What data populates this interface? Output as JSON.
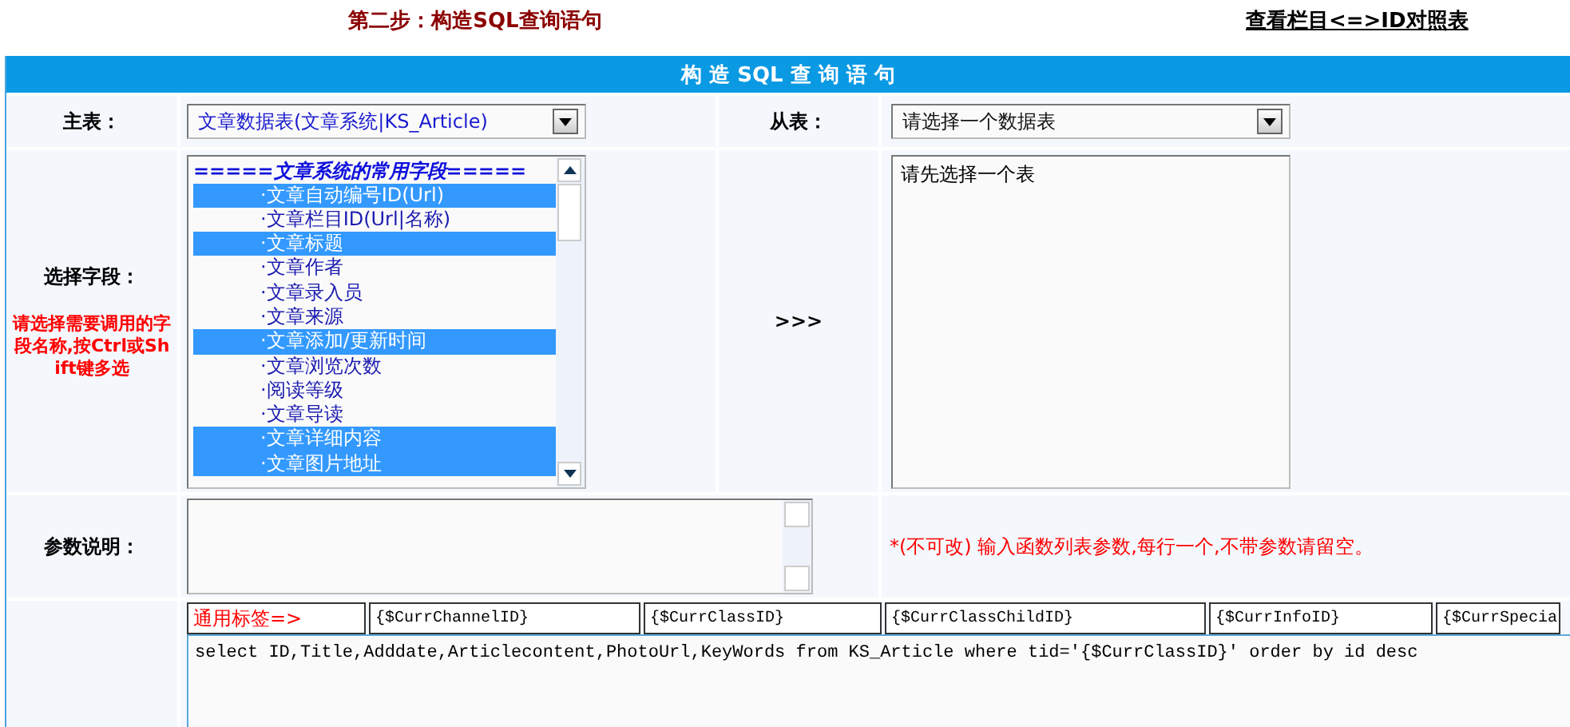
{
  "heading": {
    "title": "第二步：构造SQL查询语句",
    "link": "查看栏目<=>ID对照表"
  },
  "section_title": "构 造 SQL 查 询 语 句",
  "main_table": {
    "label": "主表：",
    "value": "文章数据表(文章系统|KS_Article)"
  },
  "sub_table": {
    "label": "从表：",
    "value": "请选择一个数据表"
  },
  "fields": {
    "label": "选择字段：",
    "hint": "请选择需要调用的字段名称,按Ctrl或Shift键多选",
    "group": "=====文章系统的常用字段=====",
    "options": [
      {
        "label": "·文章自动编号ID(Url)",
        "selected": true
      },
      {
        "label": "·文章栏目ID(Url|名称)",
        "selected": false
      },
      {
        "label": "·文章标题",
        "selected": true
      },
      {
        "label": "·文章作者",
        "selected": false
      },
      {
        "label": "·文章录入员",
        "selected": false
      },
      {
        "label": "·文章来源",
        "selected": false
      },
      {
        "label": "·文章添加/更新时间",
        "selected": true
      },
      {
        "label": "·文章浏览次数",
        "selected": false
      },
      {
        "label": "·阅读等级",
        "selected": false
      },
      {
        "label": "·文章导读",
        "selected": false
      },
      {
        "label": "·文章详细内容",
        "selected": true
      },
      {
        "label": "·文章图片地址",
        "selected": true
      }
    ]
  },
  "arrow": ">>>",
  "sub_fields": {
    "text": "请先选择一个表"
  },
  "params": {
    "label": "参数说明：",
    "hint": "*(不可改) 输入函数列表参数,每行一个,不带参数请留空。"
  },
  "tags": [
    {
      "label": "通用标签=>",
      "kind": "heading"
    },
    {
      "label": "{$CurrChannelID}",
      "kind": "tag"
    },
    {
      "label": "{$CurrClassID}",
      "kind": "tag"
    },
    {
      "label": "{$CurrClassChildID}",
      "kind": "tag"
    },
    {
      "label": "{$CurrInfoID}",
      "kind": "tag"
    },
    {
      "label": "{$CurrSpecia",
      "kind": "tag"
    }
  ],
  "sql": "select ID,Title,Adddate,Articlecontent,PhotoUrl,KeyWords from KS_Article where tid='{$CurrClassID}' order by id desc"
}
